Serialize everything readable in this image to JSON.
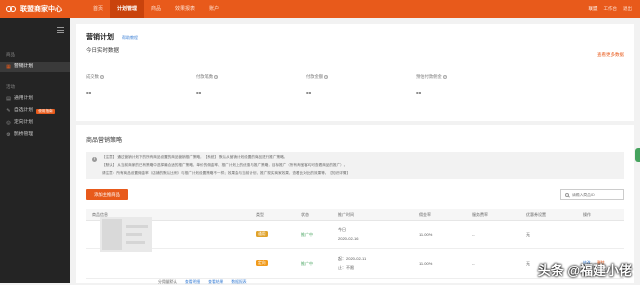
{
  "topbar": {
    "logo_text": "联盟商家中心",
    "nav": [
      "首页",
      "计划管理",
      "商品",
      "效果报表",
      "账户"
    ],
    "active_nav_index": 1,
    "user": "联盟",
    "links": [
      "工作台",
      "退出"
    ]
  },
  "sidebar": {
    "sections": [
      {
        "title": "商品",
        "items": [
          {
            "label": "营销计划",
            "icon": "chart-icon",
            "active": true
          }
        ]
      },
      {
        "title": "活动",
        "items": [
          {
            "label": "通用计划",
            "icon": "doc-icon"
          },
          {
            "label": "自选计划",
            "icon": "edit-icon",
            "badge": "使用指南"
          },
          {
            "label": "定向计划",
            "icon": "target-icon"
          },
          {
            "label": "鹊桥管理",
            "icon": "gear-icon"
          }
        ]
      }
    ]
  },
  "plan": {
    "title": "营销计划",
    "help_link": "帮助教程",
    "realtime_title": "今日实时数据",
    "view_more": "查看更多数据",
    "stats": [
      {
        "label": "成交数",
        "value": "--"
      },
      {
        "label": "付款笔数",
        "value": "--"
      },
      {
        "label": "付款金额",
        "value": "--"
      },
      {
        "label": "预估付款佣金",
        "value": "--"
      }
    ]
  },
  "strategy": {
    "title": "商品营销策略",
    "notice_lines": [
      "【注意】 通过营销计划下的所有商品设置的商品营销推广策略，【系统】 默认从营销计划设置的商品进行推广策略。",
      "【默认】 从当前商家的已有策略中选择最合适的推广策略，单价的佣金率、推广计划上的优惠与推广策略，目标推广（所有淘宝客均可查看商品的推广）。",
      "请注意：所有商品设置佣金率（店铺的默认比例）与推广计划设置策略不一样；效果会与当前计划，推广现实商家效果，查看比对比的效果等。【知识详情】"
    ],
    "add_button": "添加主推商品",
    "search_placeholder": "请输入商品ID",
    "columns": [
      "商品信息",
      "类型",
      "状态",
      "推广时间",
      "佣金率",
      "服务费率",
      "优惠券设置",
      "操作"
    ],
    "rows": [
      {
        "type": "通用",
        "status": "推广中",
        "time_start": "今日",
        "time_end": "2020-02-16",
        "rate": "11.00%",
        "service": "--",
        "coupon": "无",
        "ops": []
      },
      {
        "type": "定向",
        "status": "推广中",
        "time_start": "起：2020-02-11",
        "time_end": "止：不限",
        "rate": "11.00%",
        "service": "--",
        "coupon": "无",
        "ops": [
          "修改",
          "删除"
        ]
      }
    ],
    "footer": [
      "分佣量默认",
      "查看明细",
      "查看结果",
      "数据报表"
    ]
  },
  "watermark": "头条 @福建小佬"
}
